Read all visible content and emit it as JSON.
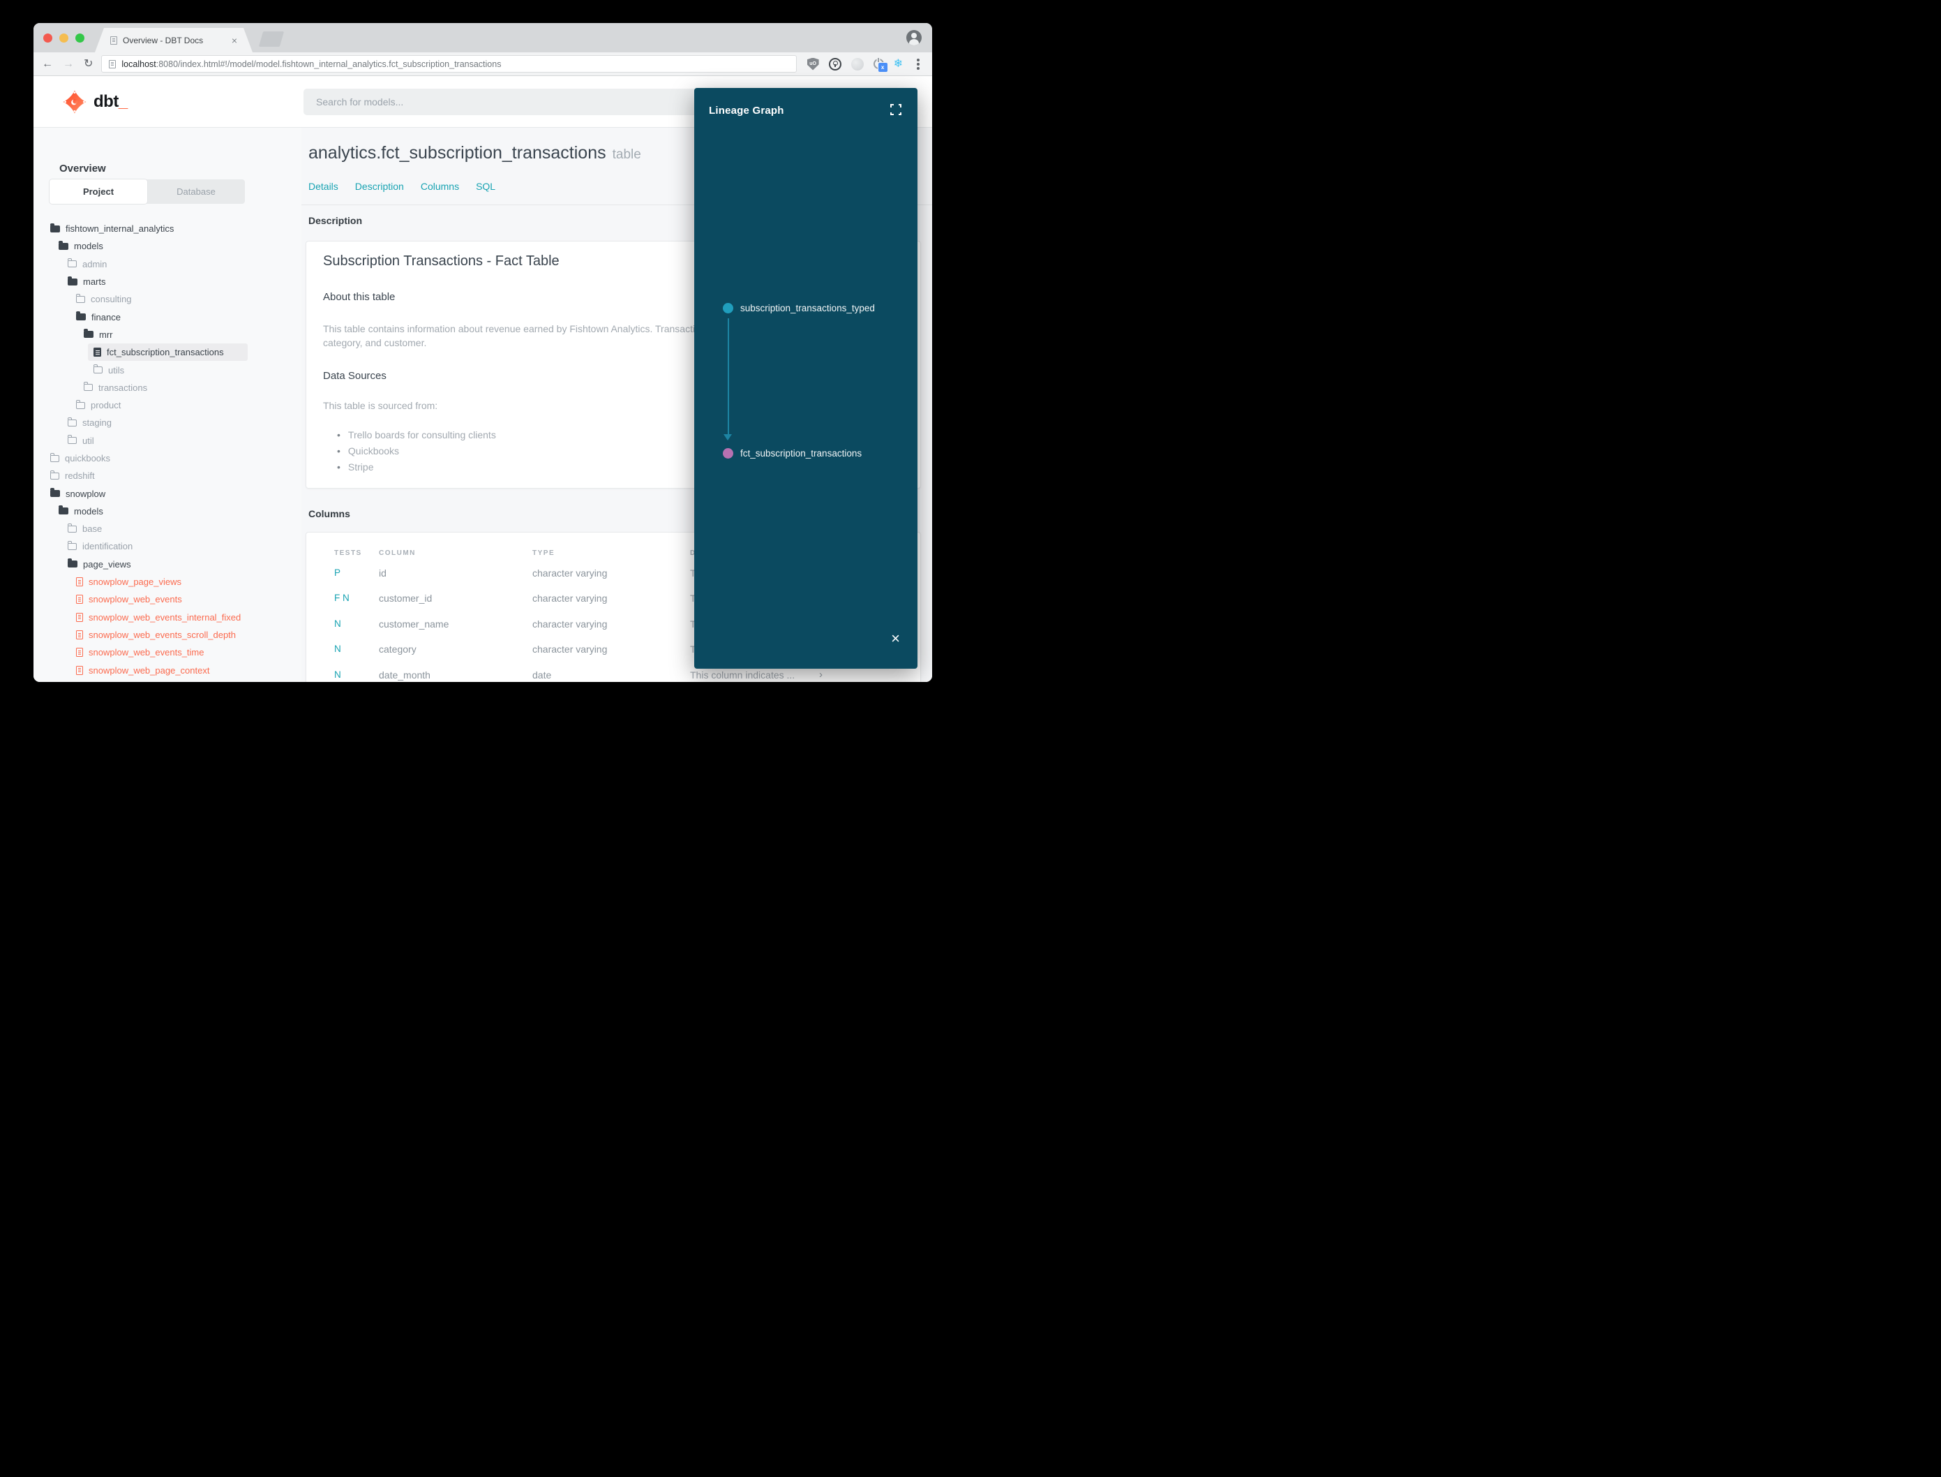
{
  "browser": {
    "tab_title": "Overview - DBT Docs",
    "url_host": "localhost",
    "url_rest": ":8080/index.html#!/model/model.fishtown_internal_analytics.fct_subscription_transactions"
  },
  "header": {
    "logo_text": "dbt",
    "logo_underscore": "_",
    "search_placeholder": "Search for models..."
  },
  "sidebar": {
    "overview_label": "Overview",
    "tabs": {
      "project": "Project",
      "database": "Database"
    },
    "tree": [
      {
        "label": "fishtown_internal_analytics",
        "icon": "folder-open-icon"
      },
      {
        "label": "models",
        "icon": "folder-open-icon"
      },
      {
        "label": "admin",
        "icon": "folder-icon"
      },
      {
        "label": "marts",
        "icon": "folder-open-icon"
      },
      {
        "label": "consulting",
        "icon": "folder-icon"
      },
      {
        "label": "finance",
        "icon": "folder-open-icon"
      },
      {
        "label": "mrr",
        "icon": "folder-open-icon"
      },
      {
        "label": "fct_subscription_transactions",
        "icon": "file-icon",
        "selected": true
      },
      {
        "label": "utils",
        "icon": "folder-icon"
      },
      {
        "label": "transactions",
        "icon": "folder-icon"
      },
      {
        "label": "product",
        "icon": "folder-icon"
      },
      {
        "label": "staging",
        "icon": "folder-icon"
      },
      {
        "label": "util",
        "icon": "folder-icon"
      },
      {
        "label": "quickbooks",
        "icon": "folder-icon"
      },
      {
        "label": "redshift",
        "icon": "folder-icon"
      },
      {
        "label": "snowplow",
        "icon": "folder-open-icon"
      },
      {
        "label": "models",
        "icon": "folder-open-icon"
      },
      {
        "label": "base",
        "icon": "folder-icon"
      },
      {
        "label": "identification",
        "icon": "folder-icon"
      },
      {
        "label": "page_views",
        "icon": "folder-open-icon"
      },
      {
        "label": "snowplow_page_views",
        "icon": "file-red-icon"
      },
      {
        "label": "snowplow_web_events",
        "icon": "file-red-icon"
      },
      {
        "label": "snowplow_web_events_internal_fixed",
        "icon": "file-red-icon"
      },
      {
        "label": "snowplow_web_events_scroll_depth",
        "icon": "file-red-icon"
      },
      {
        "label": "snowplow_web_events_time",
        "icon": "file-red-icon"
      },
      {
        "label": "snowplow_web_page_context",
        "icon": "file-red-icon"
      }
    ]
  },
  "main": {
    "title": "analytics.fct_subscription_transactions",
    "title_suffix": "table",
    "tabs": [
      "Details",
      "Description",
      "Columns",
      "SQL"
    ],
    "description_section": {
      "heading": "Description",
      "card_title": "Subscription Transactions - Fact Table",
      "about_heading": "About this table",
      "about_line1": "This table contains information about revenue earned by Fishtown Analytics. Transactions are grouped by date_month,",
      "about_line2": "category, and customer.",
      "sources_heading": "Data Sources",
      "sources_intro": "This table is sourced from:",
      "sources": [
        "Trello boards for consulting clients",
        "Quickbooks",
        "Stripe"
      ]
    },
    "columns_section": {
      "heading": "Columns",
      "table": {
        "headers": [
          "TESTS",
          "COLUMN",
          "TYPE",
          "DESCRIPTION"
        ],
        "rows": [
          {
            "tests": "P",
            "column": "id",
            "type": "character varying",
            "description": "This column indicates ..."
          },
          {
            "tests": "F N",
            "column": "customer_id",
            "type": "character varying",
            "description": "This column indicates ..."
          },
          {
            "tests": "N",
            "column": "customer_name",
            "type": "character varying",
            "description": "This column indicates ..."
          },
          {
            "tests": "N",
            "column": "category",
            "type": "character varying",
            "description": "This column indicates ..."
          },
          {
            "tests": "N",
            "column": "date_month",
            "type": "date",
            "description": "This column indicates ..."
          }
        ]
      }
    }
  },
  "lineage": {
    "title": "Lineage Graph",
    "nodes": [
      {
        "label": "subscription_transactions_typed",
        "color": "#209ebd"
      },
      {
        "label": "fct_subscription_transactions",
        "color": "#b671b1"
      }
    ]
  },
  "colors": {
    "accent_teal": "#18a3b2",
    "model_red": "#fb6a4e",
    "panel_bg": "#0b4a60",
    "logo_orange": "#ff5c35"
  }
}
